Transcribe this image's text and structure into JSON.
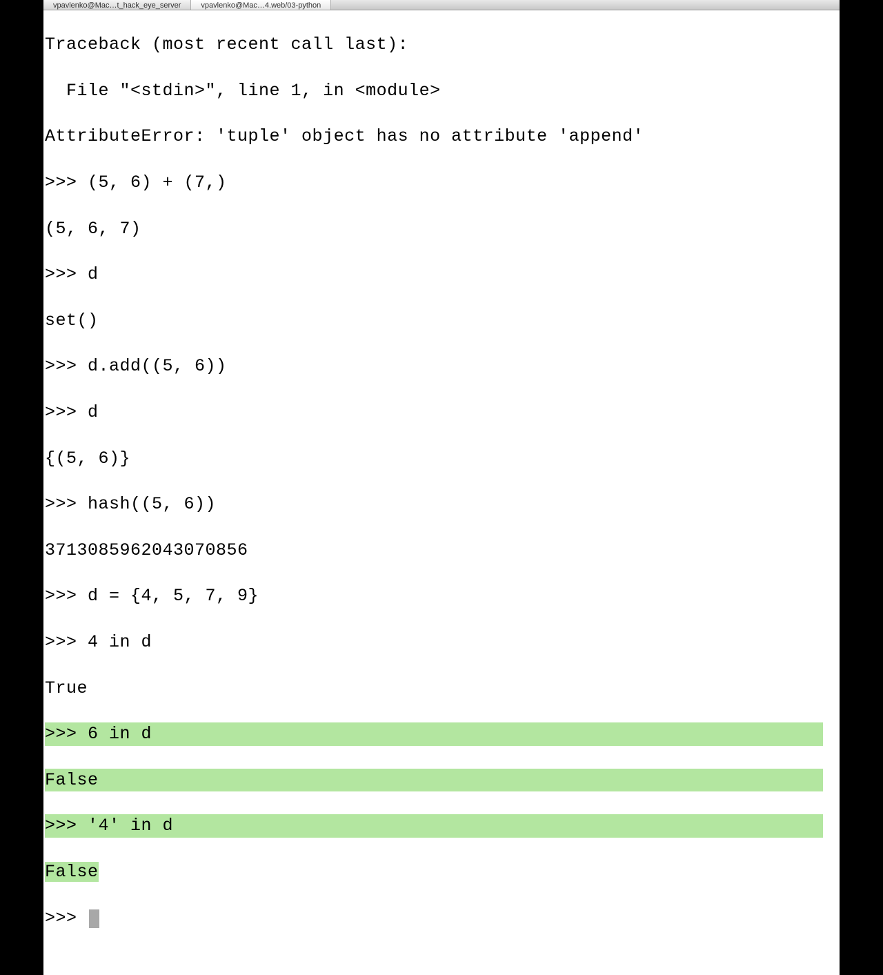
{
  "tabs": [
    {
      "label": "vpavlenko@Mac…t_hack_eye_server"
    },
    {
      "label": "vpavlenko@Mac…4.web/03-python"
    }
  ],
  "terminal": {
    "lines": [
      "Traceback (most recent call last):",
      "  File \"<stdin>\", line 1, in <module>",
      "AttributeError: 'tuple' object has no attribute 'append'",
      ">>> (5, 6) + (7,)",
      "(5, 6, 7)",
      ">>> d",
      "set()",
      ">>> d.add((5, 6))",
      ">>> d",
      "{(5, 6)}",
      ">>> hash((5, 6))",
      "3713085962043070856",
      ">>> d = {4, 5, 7, 9}",
      ">>> 4 in d",
      "True",
      ">>> 6 in d",
      "False",
      ">>> '4' in d"
    ],
    "false_tail": "False",
    "prompt": ">>> "
  }
}
